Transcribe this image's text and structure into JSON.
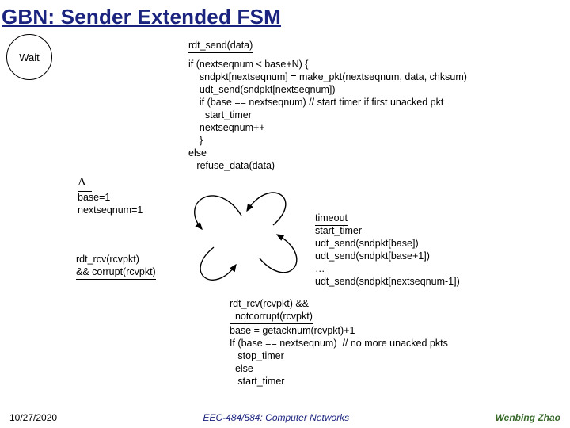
{
  "title": "GBN: Sender Extended FSM",
  "events": {
    "rdt_send": "rdt_send(data)",
    "init_lambda": "Λ",
    "init_actions": "base=1\nnextseqnum=1",
    "timeout": "timeout",
    "timeout_actions": "start_timer\nudt_send(sndpkt[base])\nudt_send(sndpkt[base+1])\n…\nudt_send(sndpkt[nextseqnum-1])",
    "rcv_corrupt": "rdt_rcv(rcvpkt)\n&& corrupt(rcvpkt)",
    "rcv_notcorrupt": "rdt_rcv(rcvpkt) &&\n  notcorrupt(rcvpkt)",
    "rcv_ok_actions": "base = getacknum(rcvpkt)+1\nIf (base == nextseqnum)  // no more unacked pkts\n   stop_timer\n  else\n   start_timer"
  },
  "send_action": "if (nextseqnum < base+N) {\n    sndpkt[nextseqnum] = make_pkt(nextseqnum, data, chksum)\n    udt_send(sndpkt[nextseqnum])\n    if (base == nextseqnum) // start timer if first unacked pkt\n      start_timer\n    nextseqnum++\n    }\nelse\n   refuse_data(data)",
  "state": "Wait",
  "footer": {
    "date": "10/27/2020",
    "course": "EEC-484/584: Computer Networks",
    "author": "Wenbing Zhao"
  }
}
